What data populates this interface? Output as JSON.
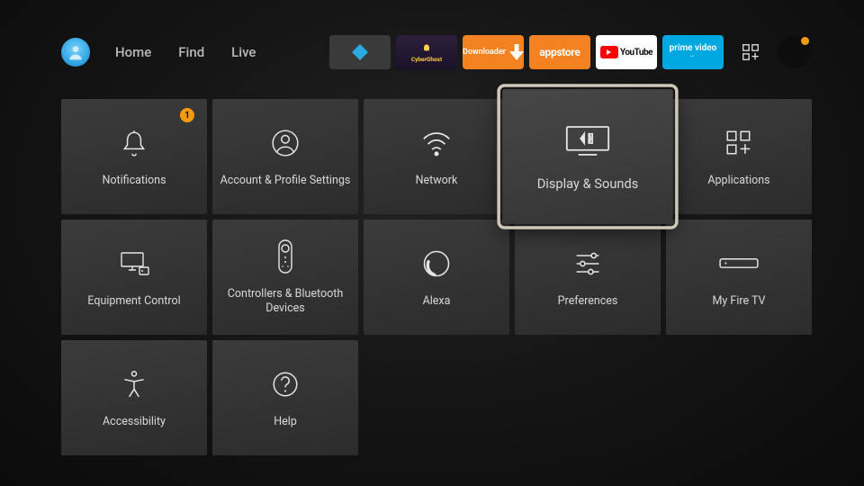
{
  "nav": {
    "items": [
      "Home",
      "Find",
      "Live"
    ],
    "apps": [
      {
        "id": "kodi",
        "label": ""
      },
      {
        "id": "cyberghost",
        "label": "CyberGhost"
      },
      {
        "id": "downloader",
        "label": "Downloader"
      },
      {
        "id": "appstore",
        "label": "appstore"
      },
      {
        "id": "youtube",
        "label": "YouTube"
      },
      {
        "id": "primevideo",
        "label": "prime video"
      }
    ]
  },
  "settings": {
    "tiles": [
      {
        "id": "notifications",
        "label": "Notifications",
        "badge": "1"
      },
      {
        "id": "account",
        "label": "Account & Profile Settings"
      },
      {
        "id": "network",
        "label": "Network"
      },
      {
        "id": "display",
        "label": "Display & Sounds",
        "selected": true
      },
      {
        "id": "applications",
        "label": "Applications"
      },
      {
        "id": "equipment",
        "label": "Equipment Control"
      },
      {
        "id": "controllers",
        "label": "Controllers & Bluetooth Devices"
      },
      {
        "id": "alexa",
        "label": "Alexa"
      },
      {
        "id": "preferences",
        "label": "Preferences"
      },
      {
        "id": "myfiretv",
        "label": "My Fire TV"
      },
      {
        "id": "accessibility",
        "label": "Accessibility"
      },
      {
        "id": "help",
        "label": "Help"
      }
    ]
  }
}
